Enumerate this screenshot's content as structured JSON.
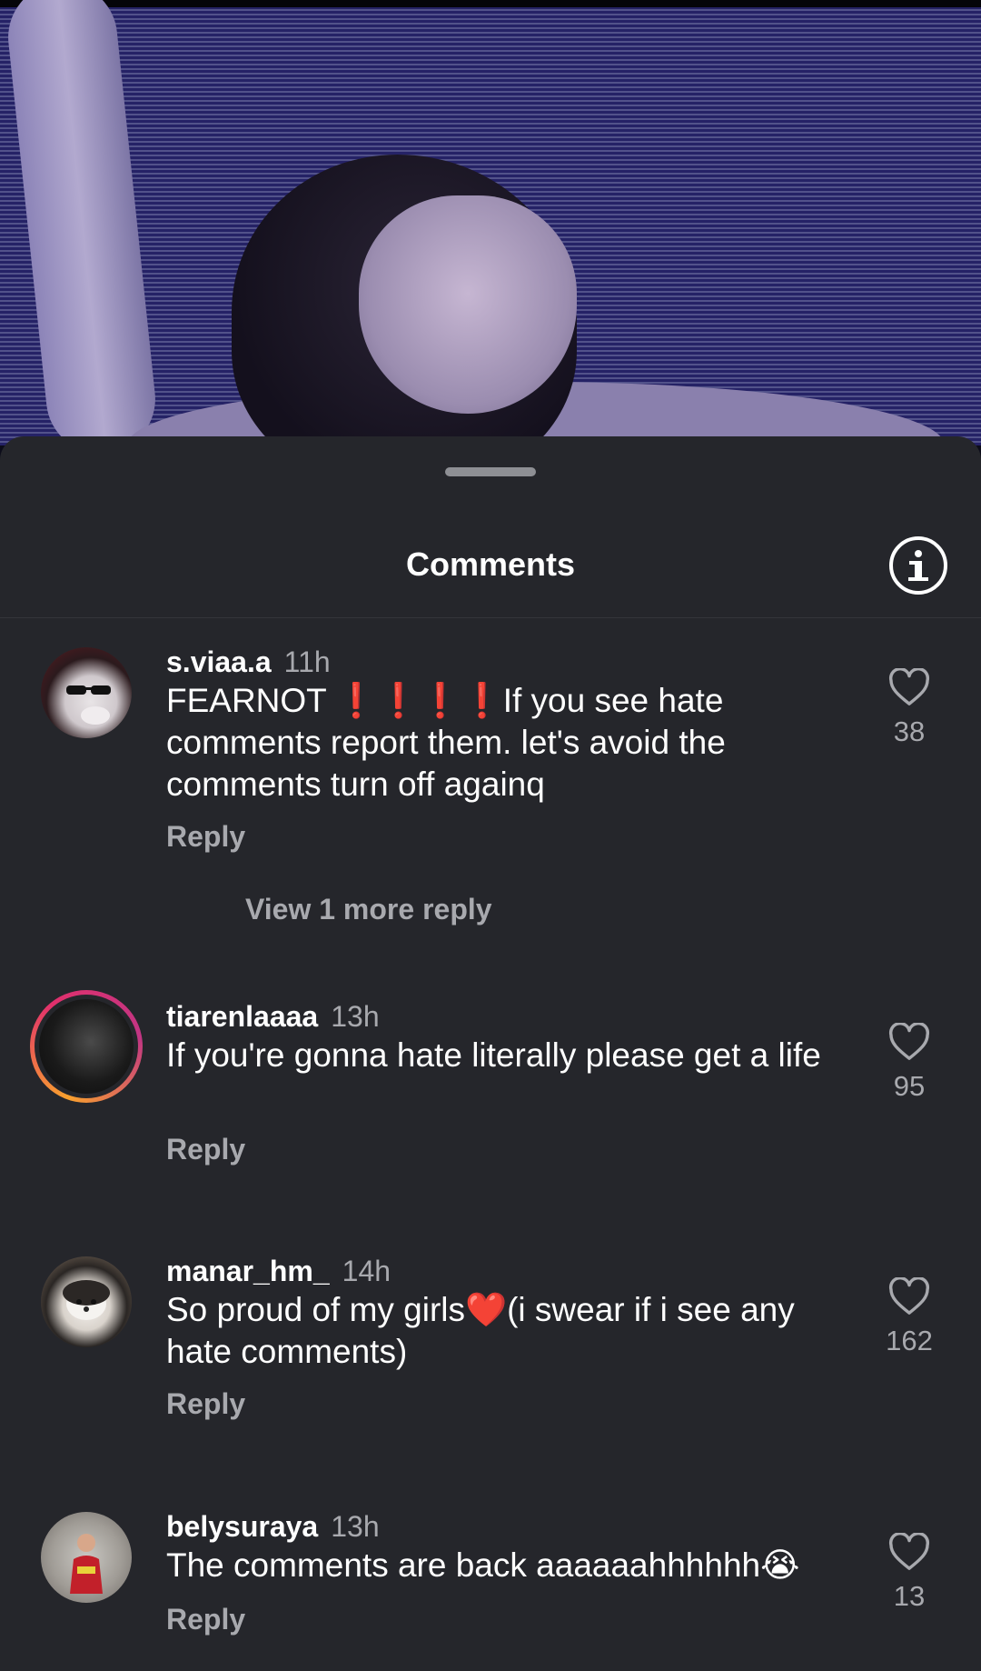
{
  "sheet": {
    "title": "Comments"
  },
  "comments": [
    {
      "username": "s.viaa.a",
      "time": "11h",
      "text_before": "FEARNOT ",
      "emphasis": "❗❗❗❗",
      "text_after": "If you see hate comments report them. let's avoid the comments turn off againq",
      "reply_label": "Reply",
      "likes": "38",
      "view_more": "View 1 more reply"
    },
    {
      "username": "tiarenlaaaa",
      "time": "13h",
      "text": "If you're gonna hate literally please get a life",
      "reply_label": "Reply",
      "likes": "95"
    },
    {
      "username": "manar_hm_",
      "time": "14h",
      "text": "So proud of my girls❤️(i swear if i see any hate comments)",
      "reply_label": "Reply",
      "likes": "162"
    },
    {
      "username": "belysuraya",
      "time": "13h",
      "text": "The comments are back aaaaaahhhhhh😭",
      "reply_label": "Reply",
      "likes": "13"
    }
  ],
  "colors": {
    "sheet_bg": "#25262b",
    "secondary_text": "#a8a9ae",
    "primary_text": "#ffffff"
  }
}
